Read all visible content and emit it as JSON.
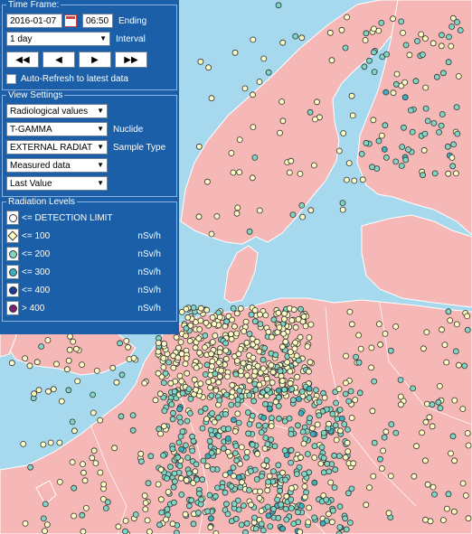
{
  "colors": {
    "sea": "#a6d8ee",
    "land": "#f6b8b6",
    "panel_bg": "#1a5fa8",
    "level_detection": "#ffffff",
    "level_100": "#fffcc4",
    "level_200": "#7fd6c4",
    "level_300": "#3db0c0",
    "level_400": "#1b3c98",
    "level_over": "#7a1f70"
  },
  "time_frame": {
    "legend": "Time Frame:",
    "date": "2016-01-07",
    "time": "06:50",
    "ending_label": "Ending",
    "interval_value": "1 day",
    "interval_label": "Interval",
    "nav": [
      "◀◀",
      "◀",
      "▶",
      "▶▶"
    ],
    "auto_refresh_label": "Auto-Refresh to latest data",
    "auto_refresh_checked": false
  },
  "view_settings": {
    "legend": "View Settings",
    "values_type": "Radiological values",
    "nuclide_value": "T-GAMMA",
    "nuclide_label": "Nuclide",
    "sample_value": "EXTERNAL RADIAT",
    "sample_label": "Sample Type",
    "data_type": "Measured data",
    "value_mode": "Last Value"
  },
  "radiation_levels": {
    "legend": "Radiation Levels",
    "items": [
      {
        "op": "<=",
        "value": "DETECTION LIMIT",
        "unit": "",
        "symbol": "dot",
        "color_key": "level_detection"
      },
      {
        "op": "<=",
        "value": "100",
        "unit": "nSv/h",
        "symbol": "diamond",
        "color_key": "level_100"
      },
      {
        "op": "<=",
        "value": "200",
        "unit": "nSv/h",
        "symbol": "dot",
        "color_key": "level_200"
      },
      {
        "op": "<=",
        "value": "300",
        "unit": "nSv/h",
        "symbol": "dot",
        "color_key": "level_300"
      },
      {
        "op": "<=",
        "value": "400",
        "unit": "nSv/h",
        "symbol": "dot",
        "color_key": "level_400"
      },
      {
        "op": ">",
        "value": "400",
        "unit": "nSv/h",
        "symbol": "dot",
        "color_key": "level_over"
      }
    ]
  }
}
